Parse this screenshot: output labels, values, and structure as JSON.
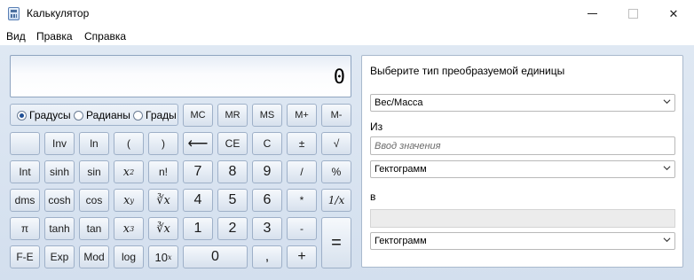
{
  "window": {
    "title": "Калькулятор",
    "close_glyph": "✕"
  },
  "menu": [
    "Вид",
    "Правка",
    "Справка"
  ],
  "display": {
    "value": "0"
  },
  "angle_units": {
    "options": [
      "Градусы",
      "Радианы",
      "Грады"
    ],
    "selected": "Градусы"
  },
  "memory_buttons": [
    "MC",
    "MR",
    "MS",
    "M+",
    "M-"
  ],
  "keys": {
    "inv": "Inv",
    "ln": "ln",
    "lparen": "(",
    "rparen": ")",
    "backspace": "⟵",
    "ce": "CE",
    "c": "C",
    "plusminus": "±",
    "sqrt": "√",
    "int": "Int",
    "sinh": "sinh",
    "sin": "sin",
    "x": "x",
    "sq_exp": "2",
    "fact": "n!",
    "n7": "7",
    "n8": "8",
    "n9": "9",
    "div": "/",
    "percent": "%",
    "dms": "dms",
    "cosh": "cosh",
    "cos": "cos",
    "pow_exp": "y",
    "yroot": "∛x",
    "n4": "4",
    "n5": "5",
    "n6": "6",
    "mul": "*",
    "recip": "1/x",
    "pi": "π",
    "tanh": "tanh",
    "tan": "tan",
    "cube_exp": "3",
    "cuberoot": "∛x",
    "n1": "1",
    "n2": "2",
    "n3": "3",
    "minus": "-",
    "equals": "=",
    "fe": "F-E",
    "exp": "Exp",
    "mod": "Mod",
    "log": "log",
    "ten": "10",
    "ten_exp": "x",
    "n0": "0",
    "decimal": ",",
    "plus": "+"
  },
  "converter": {
    "heading": "Выберите тип преобразуемой единицы",
    "type": "Вес/Масса",
    "from_label": "Из",
    "input_placeholder": "Ввод значения",
    "from_unit": "Гектограмм",
    "to_label": "в",
    "to_unit": "Гектограмм"
  },
  "colors": {
    "body_bg": "#d3dfee",
    "accent": "#1f4f95"
  }
}
